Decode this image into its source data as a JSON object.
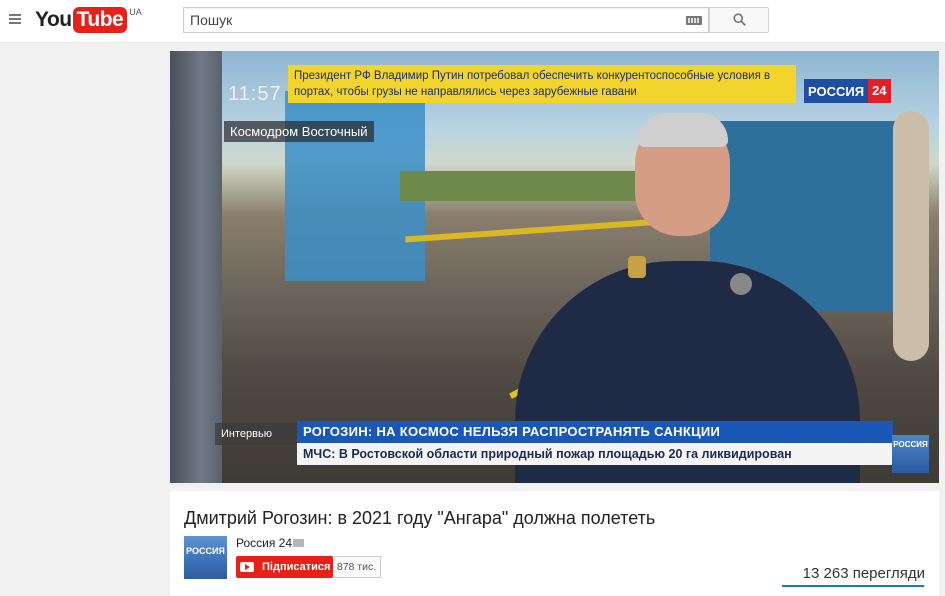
{
  "masthead": {
    "logo_you": "You",
    "logo_tube": "Tube",
    "logo_region": "UA",
    "search_placeholder": "Пошук"
  },
  "player": {
    "clock": "11:57",
    "location": "Космодром Восточный",
    "top_ticker": "Президент РФ Владимир Путин потребовал обеспечить конкурентоспособные условия в портах, чтобы грузы не направлялись через зарубежные гавани",
    "channel_logo_name": "РОССИЯ",
    "channel_logo_num": "24",
    "lower_label": "Интервью",
    "lower_headline": "РОГОЗИН: НА КОСМОС НЕЛЬЗЯ РАСПРОСТРАНЯТЬ САНКЦИИ",
    "lower_ticker": "МЧС: В Ростовской области природный пожар площадью 20 га ликвидирован",
    "corner_logo": "РОССИЯ"
  },
  "video": {
    "title": "Дмитрий Рогозин: в 2021 году \"Ангара\" должна полететь",
    "channel_name": "Россия 24",
    "avatar_text": "РОССИЯ",
    "subscribe_label": "Підписатися",
    "subscriber_count": "878 тис.",
    "views": "13 263 перегляди"
  },
  "colors": {
    "youtube_red": "#e62117",
    "rossiya_blue": "#1a57b6",
    "ticker_yellow": "#f1d52d",
    "link_blue": "#167ac6"
  }
}
